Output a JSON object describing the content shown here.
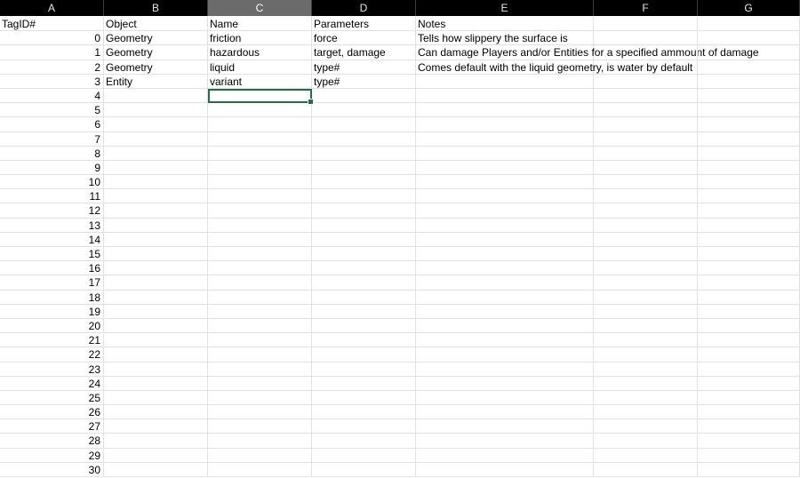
{
  "columns": [
    "A",
    "B",
    "C",
    "D",
    "E",
    "F",
    "G"
  ],
  "selected_column": "C",
  "header_row": [
    "TagID#",
    "Object",
    "Name",
    "Parameters",
    "Notes",
    "",
    ""
  ],
  "data_rows": [
    [
      "0",
      "Geometry",
      "friction",
      "force",
      "Tells how slippery the surface is",
      "",
      ""
    ],
    [
      "1",
      "Geometry",
      "hazardous",
      "target, damage",
      "Can damage Players and/or Entities for a specified ammount of damage",
      "",
      ""
    ],
    [
      "2",
      "Geometry",
      "liquid",
      "type#",
      "Comes default with the liquid geometry, is water by default",
      "",
      ""
    ],
    [
      "3",
      "Entity",
      "variant",
      "type#",
      "",
      "",
      ""
    ],
    [
      "4",
      "",
      "",
      "",
      "",
      "",
      ""
    ],
    [
      "5",
      "",
      "",
      "",
      "",
      "",
      ""
    ],
    [
      "6",
      "",
      "",
      "",
      "",
      "",
      ""
    ],
    [
      "7",
      "",
      "",
      "",
      "",
      "",
      ""
    ],
    [
      "8",
      "",
      "",
      "",
      "",
      "",
      ""
    ],
    [
      "9",
      "",
      "",
      "",
      "",
      "",
      ""
    ],
    [
      "10",
      "",
      "",
      "",
      "",
      "",
      ""
    ],
    [
      "11",
      "",
      "",
      "",
      "",
      "",
      ""
    ],
    [
      "12",
      "",
      "",
      "",
      "",
      "",
      ""
    ],
    [
      "13",
      "",
      "",
      "",
      "",
      "",
      ""
    ],
    [
      "14",
      "",
      "",
      "",
      "",
      "",
      ""
    ],
    [
      "15",
      "",
      "",
      "",
      "",
      "",
      ""
    ],
    [
      "16",
      "",
      "",
      "",
      "",
      "",
      ""
    ],
    [
      "17",
      "",
      "",
      "",
      "",
      "",
      ""
    ],
    [
      "18",
      "",
      "",
      "",
      "",
      "",
      ""
    ],
    [
      "19",
      "",
      "",
      "",
      "",
      "",
      ""
    ],
    [
      "20",
      "",
      "",
      "",
      "",
      "",
      ""
    ],
    [
      "21",
      "",
      "",
      "",
      "",
      "",
      ""
    ],
    [
      "22",
      "",
      "",
      "",
      "",
      "",
      ""
    ],
    [
      "23",
      "",
      "",
      "",
      "",
      "",
      ""
    ],
    [
      "24",
      "",
      "",
      "",
      "",
      "",
      ""
    ],
    [
      "25",
      "",
      "",
      "",
      "",
      "",
      ""
    ],
    [
      "26",
      "",
      "",
      "",
      "",
      "",
      ""
    ],
    [
      "27",
      "",
      "",
      "",
      "",
      "",
      ""
    ],
    [
      "28",
      "",
      "",
      "",
      "",
      "",
      ""
    ],
    [
      "29",
      "",
      "",
      "",
      "",
      "",
      ""
    ],
    [
      "30",
      "",
      "",
      "",
      "",
      "",
      ""
    ]
  ],
  "active_cell": {
    "row": 4,
    "col": 2
  }
}
